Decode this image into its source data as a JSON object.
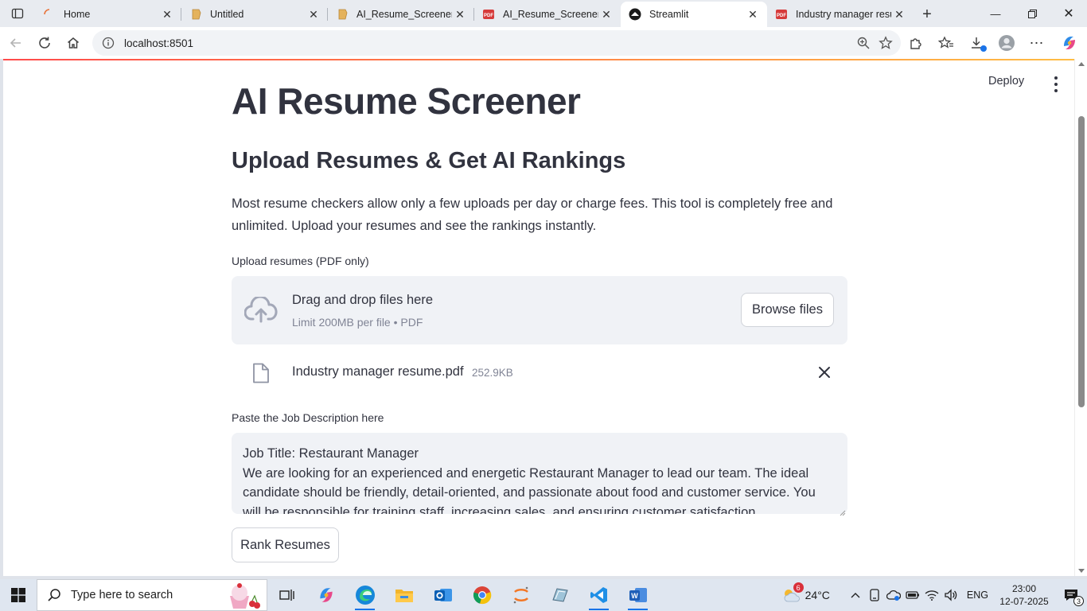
{
  "browser": {
    "tabs": [
      {
        "label": "Home",
        "icon": "loading-spinner-icon",
        "active": false
      },
      {
        "label": "Untitled",
        "icon": "notebook-icon",
        "active": false
      },
      {
        "label": "AI_Resume_Screener",
        "icon": "notebook-icon",
        "active": false
      },
      {
        "label": "AI_Resume_Screener.pdf",
        "icon": "pdf-icon",
        "active": false
      },
      {
        "label": "Streamlit",
        "icon": "streamlit-icon",
        "active": true
      },
      {
        "label": "Industry manager resume",
        "icon": "pdf-icon",
        "active": false
      }
    ],
    "url": "localhost:8501"
  },
  "app": {
    "deploy_label": "Deploy",
    "title": "AI Resume Screener",
    "subtitle": "Upload Resumes & Get AI Rankings",
    "description": "Most resume checkers allow only a few uploads per day or charge fees. This tool is completely free and unlimited. Upload your resumes and see the rankings instantly.",
    "uploader": {
      "label": "Upload resumes (PDF only)",
      "drop_text": "Drag and drop files here",
      "limit_text": "Limit 200MB per file • PDF",
      "browse_label": "Browse files"
    },
    "uploaded_file": {
      "name": "Industry manager resume.pdf",
      "size": "252.9KB"
    },
    "job_description": {
      "label": "Paste the Job Description here",
      "value": "Job Title: Restaurant Manager\nWe are looking for an experienced and energetic Restaurant Manager to lead our team. The ideal candidate should be friendly, detail-oriented, and passionate about food and customer service. You will be responsible for training staff, increasing sales, and ensuring customer satisfaction."
    },
    "rank_button_label": "Rank Resumes"
  },
  "taskbar": {
    "search_placeholder": "Type here to search",
    "weather": {
      "temp": "24°C",
      "badge": "6"
    },
    "language": "ENG",
    "time": "23:00",
    "date": "12-07-2025",
    "notification_count": "3"
  },
  "colors": {
    "accent_red": "#ff4b4b",
    "text_dark": "#31333f",
    "muted": "#808495",
    "surface": "#f0f2f6"
  }
}
